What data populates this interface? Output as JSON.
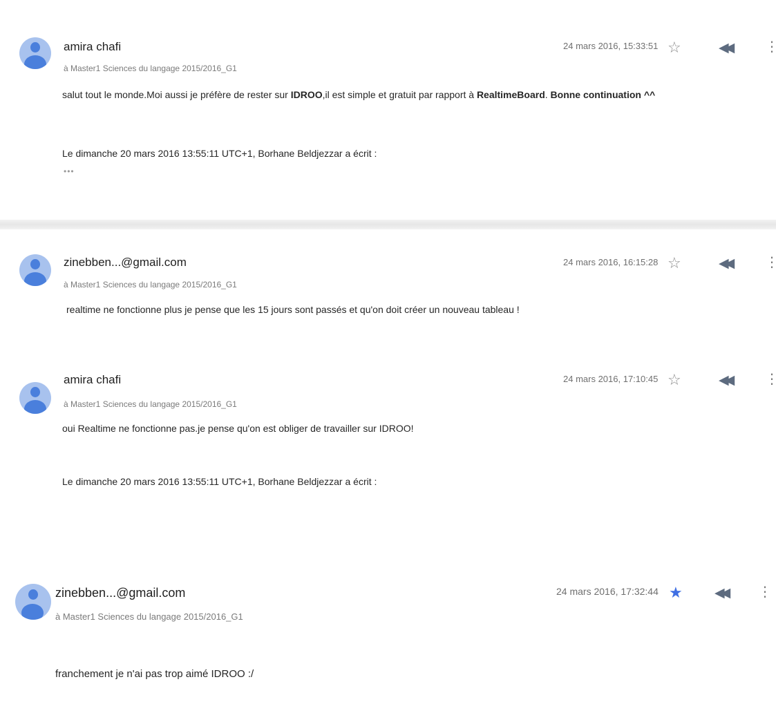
{
  "messages": [
    {
      "sender": "amira chafi",
      "recipient": "à Master1 Sciences du langage 2015/2016_G1",
      "time": "24 mars 2016, 15:33:51",
      "starred": false,
      "body_parts": [
        {
          "text": "salut tout le monde.Moi aussi je préfère de rester sur ",
          "bold": false
        },
        {
          "text": "IDROO",
          "bold": true
        },
        {
          "text": ",il est simple et gratuit par rapport à ",
          "bold": false
        },
        {
          "text": "RealtimeBoard",
          "bold": true
        },
        {
          "text": ".  ",
          "bold": false
        },
        {
          "text": "Bonne continuation ^^",
          "bold": true
        }
      ],
      "quote": "Le dimanche 20 mars 2016 13:55:11 UTC+1, Borhane Beldjezzar a écrit :",
      "ellipsis": "•••"
    },
    {
      "sender": "zinebben...@gmail.com",
      "recipient": "à Master1 Sciences du langage 2015/2016_G1",
      "time": "24 mars 2016, 16:15:28",
      "starred": false,
      "body": "realtime ne fonctionne plus je pense que les 15 jours sont passés et qu'on doit créer un nouveau tableau !"
    },
    {
      "sender": "amira chafi",
      "recipient": "à Master1 Sciences du langage 2015/2016_G1",
      "time": "24 mars 2016, 17:10:45",
      "starred": false,
      "body": "oui Realtime ne fonctionne pas.je pense qu'on est obliger de travailler sur IDROO!",
      "quote": "Le dimanche 20 mars 2016 13:55:11 UTC+1, Borhane Beldjezzar a écrit :"
    },
    {
      "sender": "zinebben...@gmail.com",
      "recipient": "à Master1 Sciences du langage 2015/2016_G1",
      "time": "24 mars 2016, 17:32:44",
      "starred": true,
      "body": "franchement je n'ai pas trop aimé IDROO :/"
    }
  ],
  "icons": {
    "star_empty": "☆",
    "star_filled": "★",
    "reply_all": "◀◀",
    "more": "⋮",
    "avatar": "person-avatar-icon"
  },
  "colors": {
    "avatar_bg": "#a8c2ee",
    "avatar_fg": "#4a7fdc",
    "star_filled": "#3f6fe3"
  }
}
